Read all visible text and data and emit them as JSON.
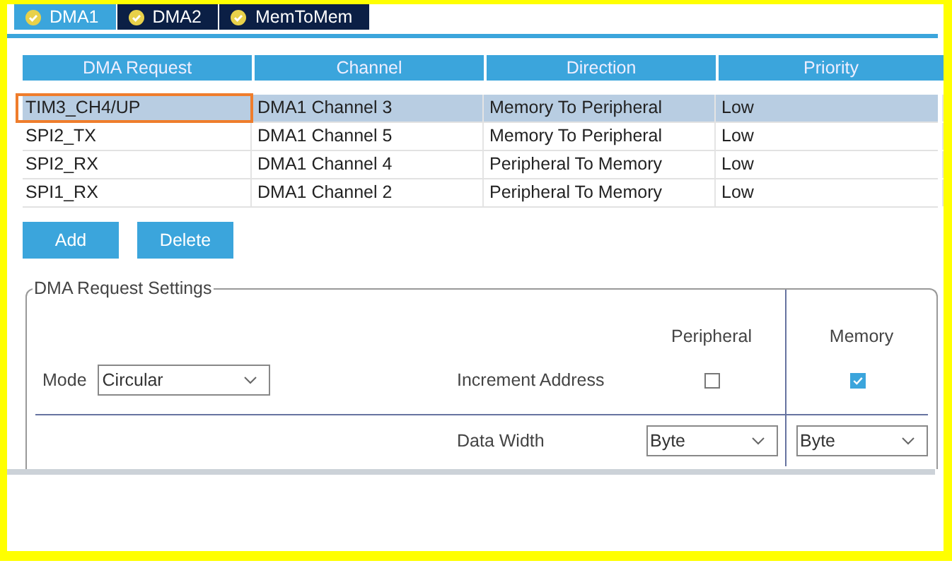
{
  "tabs": [
    {
      "label": "DMA1",
      "selected": true
    },
    {
      "label": "DMA2",
      "selected": false
    },
    {
      "label": "MemToMem",
      "selected": false
    }
  ],
  "table": {
    "columns": [
      "DMA Request",
      "Channel",
      "Direction",
      "Priority"
    ],
    "rows": [
      {
        "cells": [
          "TIM3_CH4/UP",
          "DMA1 Channel 3",
          "Memory To Peripheral",
          "Low"
        ],
        "selected": true,
        "highlighted": true
      },
      {
        "cells": [
          "SPI2_TX",
          "DMA1 Channel 5",
          "Memory To Peripheral",
          "Low"
        ],
        "selected": false,
        "highlighted": false
      },
      {
        "cells": [
          "SPI2_RX",
          "DMA1 Channel 4",
          "Peripheral To Memory",
          "Low"
        ],
        "selected": false,
        "highlighted": false
      },
      {
        "cells": [
          "SPI1_RX",
          "DMA1 Channel 2",
          "Peripheral To Memory",
          "Low"
        ],
        "selected": false,
        "highlighted": false
      }
    ]
  },
  "buttons": [
    "Add",
    "Delete"
  ],
  "settings": {
    "title": "DMA Request Settings",
    "mode_label": "Mode",
    "mode": "Circular",
    "peripheral_heading": "Peripheral",
    "memory_heading": "Memory",
    "increment_label": "Increment Address",
    "peripheral_increment": false,
    "memory_increment": true,
    "data_width_label": "Data Width",
    "peripheral_width": "Byte",
    "memory_width": "Byte"
  }
}
